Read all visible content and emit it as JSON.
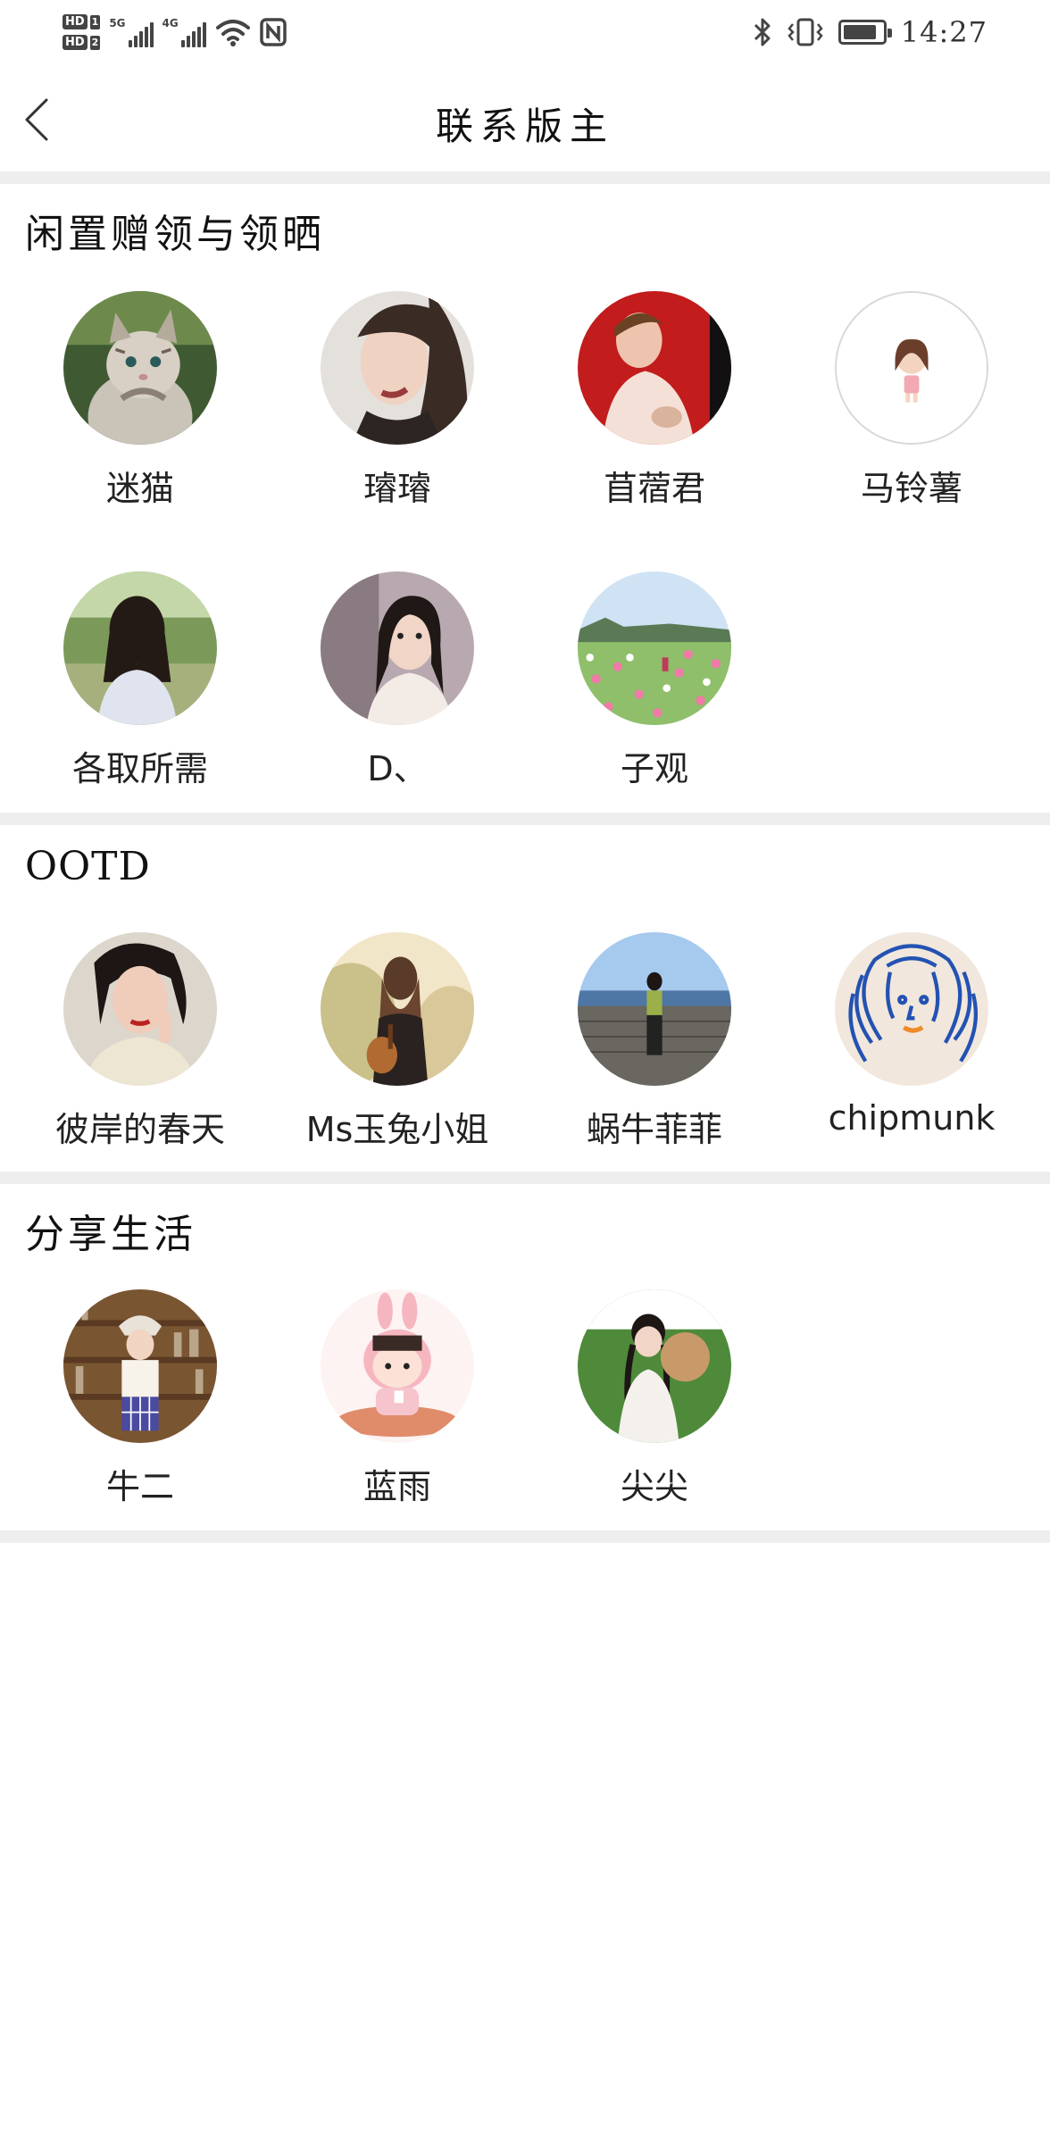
{
  "status_bar": {
    "hd1": "HD",
    "hd1_num": "1",
    "hd2": "HD",
    "hd2_num": "2",
    "sim1": "5G",
    "sim2": "4G",
    "battery_level": 0.85,
    "time": "14:27"
  },
  "header": {
    "title": "联系版主"
  },
  "sections": [
    {
      "title": "闲置赠领与领晒",
      "members": [
        {
          "name": "迷猫"
        },
        {
          "name": "璿璿"
        },
        {
          "name": "苜蓿君"
        },
        {
          "name": "马铃薯"
        },
        {
          "name": "各取所需"
        },
        {
          "name": "D、"
        },
        {
          "name": "子观"
        }
      ]
    },
    {
      "title": "OOTD",
      "members": [
        {
          "name": "彼岸的春天"
        },
        {
          "name": "Ms玉兔小姐"
        },
        {
          "name": "蜗牛菲菲"
        },
        {
          "name": "chipmunk"
        }
      ]
    },
    {
      "title": "分享生活",
      "members": [
        {
          "name": "牛二"
        },
        {
          "name": "蓝雨"
        },
        {
          "name": "尖尖"
        }
      ]
    }
  ]
}
